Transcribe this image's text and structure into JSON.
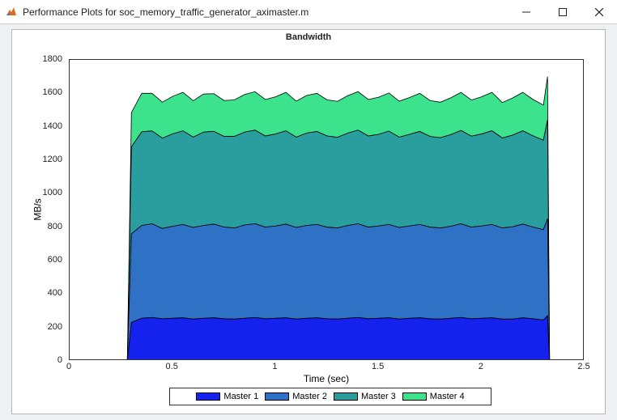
{
  "window": {
    "title": "Performance Plots for soc_memory_traffic_generator_aximaster.m"
  },
  "chart_data": {
    "type": "area",
    "title": "Bandwidth",
    "xlabel": "Time (sec)",
    "ylabel": "MB/s",
    "xlim": [
      0,
      2.5
    ],
    "ylim": [
      0,
      1800
    ],
    "xticks": [
      0,
      0.5,
      1,
      1.5,
      2,
      2.5
    ],
    "yticks": [
      0,
      200,
      400,
      600,
      800,
      1000,
      1200,
      1400,
      1600,
      1800
    ],
    "x": [
      0,
      0.28,
      0.3,
      0.35,
      0.4,
      0.45,
      0.5,
      0.55,
      0.6,
      0.65,
      0.7,
      0.75,
      0.8,
      0.85,
      0.9,
      0.95,
      1.0,
      1.05,
      1.1,
      1.15,
      1.2,
      1.25,
      1.3,
      1.35,
      1.4,
      1.45,
      1.5,
      1.55,
      1.6,
      1.65,
      1.7,
      1.75,
      1.8,
      1.85,
      1.9,
      1.95,
      2.0,
      2.05,
      2.1,
      2.15,
      2.2,
      2.25,
      2.3,
      2.32,
      2.33
    ],
    "series": [
      {
        "name": "Master 1",
        "color": "#1522ed",
        "values": [
          0,
          0,
          230,
          255,
          260,
          252,
          255,
          258,
          250,
          255,
          258,
          252,
          250,
          255,
          260,
          252,
          255,
          258,
          250,
          255,
          258,
          252,
          250,
          255,
          260,
          252,
          255,
          258,
          250,
          255,
          258,
          252,
          250,
          255,
          260,
          252,
          255,
          258,
          250,
          250,
          258,
          252,
          245,
          270,
          0
        ]
      },
      {
        "name": "Master 2",
        "color": "#2f71c4",
        "values": [
          0,
          0,
          530,
          555,
          560,
          540,
          550,
          558,
          548,
          555,
          560,
          548,
          545,
          558,
          560,
          548,
          552,
          560,
          548,
          555,
          558,
          548,
          545,
          555,
          560,
          548,
          552,
          558,
          548,
          552,
          558,
          548,
          545,
          550,
          560,
          548,
          552,
          558,
          545,
          552,
          560,
          548,
          540,
          580,
          0
        ]
      },
      {
        "name": "Master 3",
        "color": "#2a9e9e",
        "values": [
          0,
          0,
          520,
          560,
          555,
          540,
          552,
          560,
          540,
          558,
          555,
          542,
          548,
          555,
          560,
          545,
          550,
          558,
          540,
          552,
          556,
          545,
          542,
          552,
          560,
          545,
          548,
          558,
          540,
          548,
          556,
          542,
          540,
          548,
          558,
          544,
          550,
          560,
          538,
          548,
          558,
          545,
          535,
          590,
          0
        ]
      },
      {
        "name": "Master 4",
        "color": "#3de28c",
        "values": [
          0,
          0,
          205,
          230,
          225,
          215,
          225,
          230,
          218,
          228,
          225,
          215,
          218,
          225,
          230,
          218,
          222,
          230,
          215,
          225,
          228,
          216,
          215,
          224,
          230,
          218,
          222,
          228,
          215,
          220,
          228,
          215,
          212,
          220,
          228,
          216,
          222,
          230,
          212,
          222,
          230,
          218,
          210,
          260,
          0
        ]
      }
    ],
    "legend": {
      "items": [
        {
          "label": "Master 1",
          "color": "#1522ed"
        },
        {
          "label": "Master 2",
          "color": "#2f71c4"
        },
        {
          "label": "Master 3",
          "color": "#2a9e9e"
        },
        {
          "label": "Master 4",
          "color": "#3de28c"
        }
      ]
    }
  }
}
